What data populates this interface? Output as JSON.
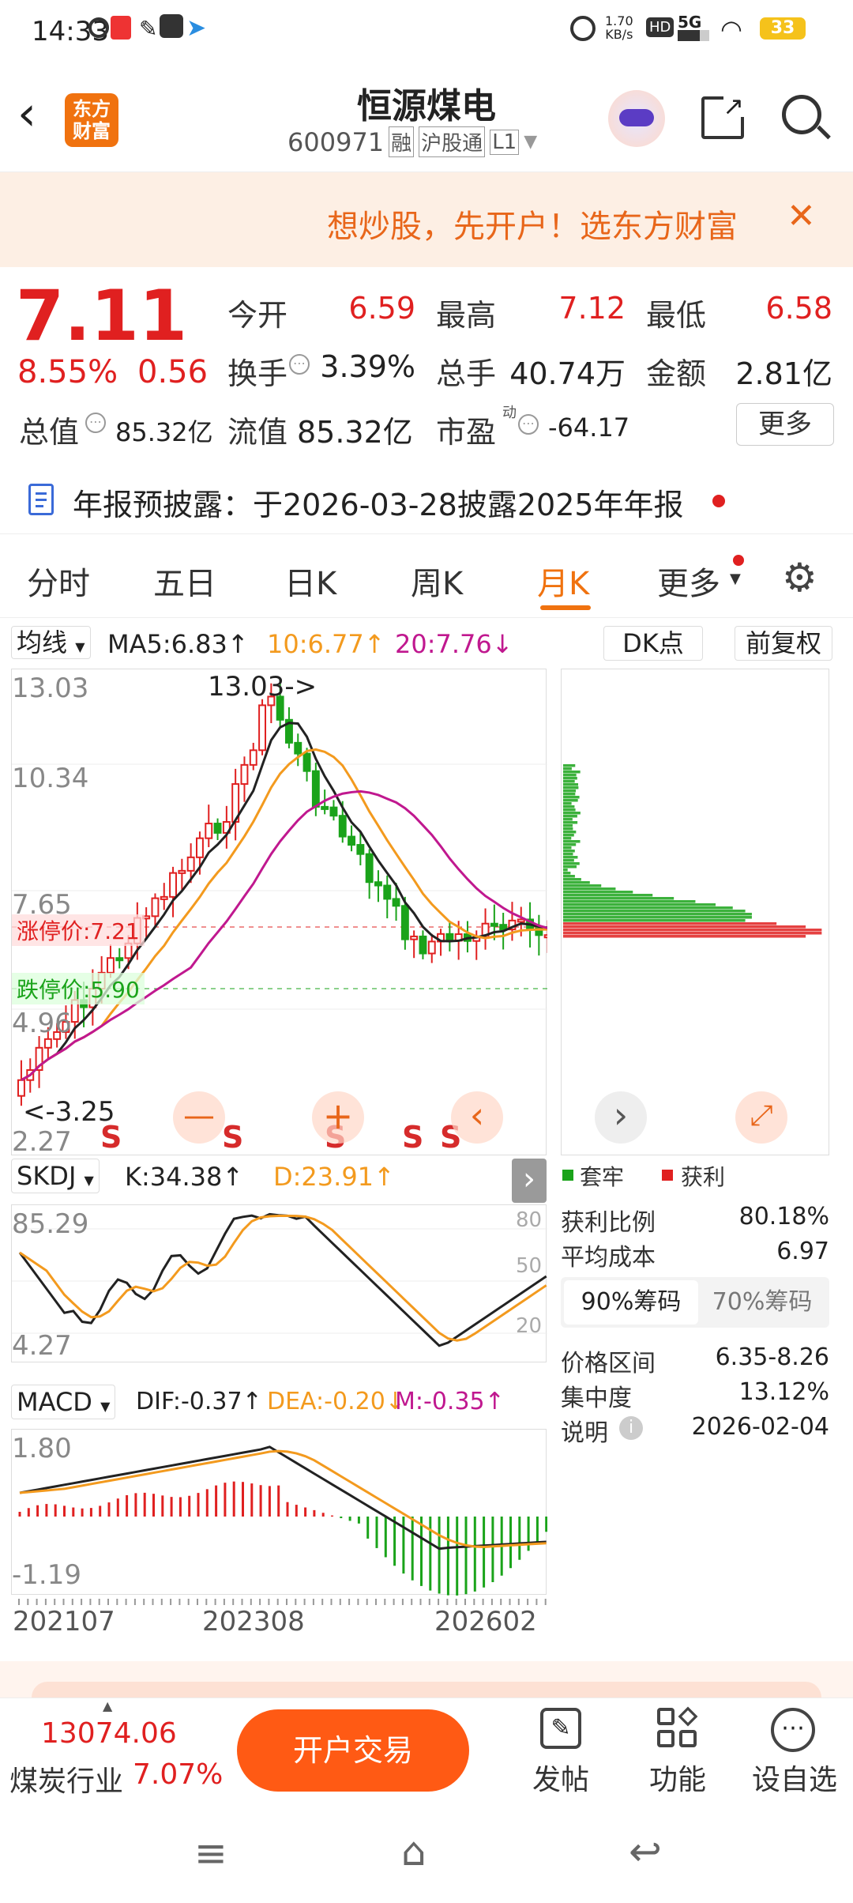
{
  "status": {
    "time": "14:33",
    "net_speed": "1.70",
    "net_unit": "KB/s",
    "hd": "HD",
    "signal": "5G",
    "battery": "33"
  },
  "header": {
    "logo_line1": "东方",
    "logo_line2": "财富",
    "title": "恒源煤电",
    "code": "600971",
    "tags": [
      "融",
      "沪股通",
      "L1"
    ]
  },
  "banner": {
    "text": "想炒股，先开户！选东方财富"
  },
  "quote": {
    "price": "7.11",
    "change_pct": "8.55%",
    "change": "0.56",
    "open_label": "今开",
    "open": "6.59",
    "high_label": "最高",
    "high": "7.12",
    "low_label": "最低",
    "low": "6.58",
    "turnover_label": "换手",
    "turnover": "3.39%",
    "volume_label": "总手",
    "volume": "40.74万",
    "amount_label": "金额",
    "amount": "2.81亿",
    "mcap_label": "总值",
    "mcap": "85.32亿",
    "float_label": "流值",
    "float": "85.32亿",
    "pe_label": "市盈",
    "pe_sup": "动",
    "pe": "-64.17",
    "more_label": "更多"
  },
  "notice": {
    "text": "年报预披露：于2026-03-28披露2025年年报"
  },
  "tabs": [
    "分时",
    "五日",
    "日K",
    "周K",
    "月K",
    "更多"
  ],
  "active_tab": "月K",
  "chart": {
    "ma_selector": "均线",
    "ma5": "MA5:6.83↑",
    "ma10": "10:6.77↑",
    "ma20": "20:7.76↓",
    "dk_label": "DK点",
    "fq_label": "前复权",
    "price_ticks": [
      "13.03",
      "10.34",
      "7.65",
      "4.96",
      "2.27"
    ],
    "high_note": "13.03->",
    "low_note": "<-3.25",
    "limit_up": "涨停价:7.21",
    "limit_down": "跌停价:5.90",
    "s_marks": [
      "S",
      "S",
      "S",
      "S",
      "S"
    ],
    "kdj_selector": "SKDJ",
    "kdj_k": "K:34.38↑",
    "kdj_d": "D:23.91↑",
    "kdj_ticks": [
      "85.29",
      "4.27"
    ],
    "kdj_right": [
      "80",
      "50",
      "20"
    ],
    "macd_selector": "MACD",
    "dif": "DIF:-0.37↑",
    "dea": "DEA:-0.20↓",
    "m": "M:-0.35↑",
    "macd_ticks": [
      "1.80",
      "-1.19"
    ],
    "dates": [
      "202107",
      "202308",
      "202602"
    ]
  },
  "chips": {
    "legend_trapped": "套牢",
    "legend_profit": "获利",
    "profit_ratio_label": "获利比例",
    "profit_ratio": "80.18%",
    "avg_cost_label": "平均成本",
    "avg_cost": "6.97",
    "tab90": "90%筹码",
    "tab70": "70%筹码",
    "range_label": "价格区间",
    "range": "6.35-8.26",
    "conc_label": "集中度",
    "conc": "13.12%",
    "note_label": "说明",
    "note_date": "2026-02-04"
  },
  "bottom": {
    "index_value": "13074.06",
    "industry": "煤炭行业",
    "industry_pct": "7.07%",
    "trade_btn": "开户交易",
    "post": "发帖",
    "func": "功能",
    "watch": "设自选"
  },
  "colors": {
    "red": "#e02020",
    "green": "#1aa31a",
    "orange": "#ff6a1a",
    "accent": "#f0720f"
  }
}
